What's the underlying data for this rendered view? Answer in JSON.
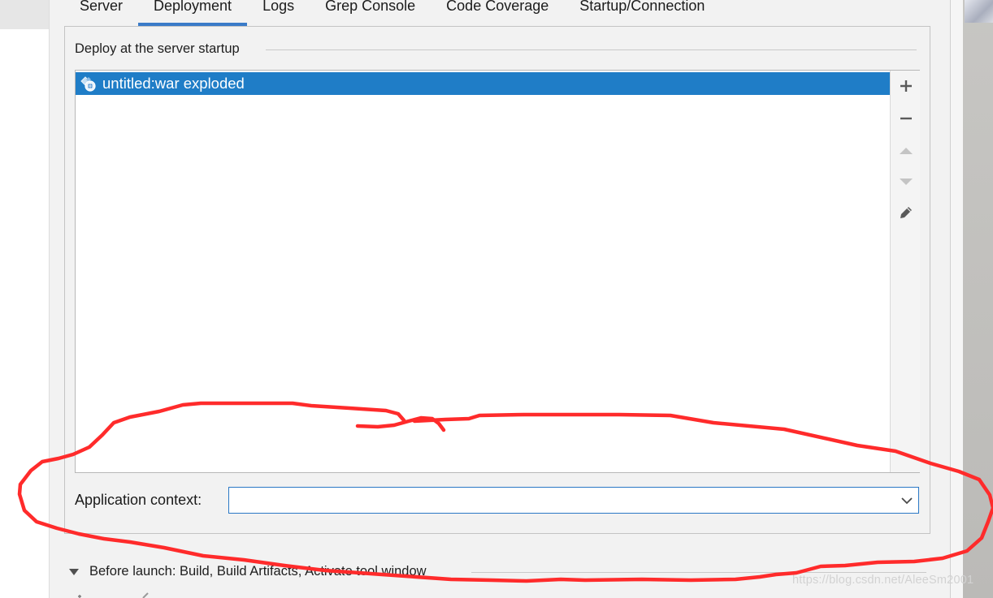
{
  "tabs": [
    {
      "label": "Server",
      "active": false
    },
    {
      "label": "Deployment",
      "active": true
    },
    {
      "label": "Logs",
      "active": false
    },
    {
      "label": "Grep Console",
      "active": false
    },
    {
      "label": "Code Coverage",
      "active": false
    },
    {
      "label": "Startup/Connection",
      "active": false
    }
  ],
  "deploy": {
    "section_title": "Deploy at the server startup",
    "items": [
      {
        "label": "untitled:war exploded",
        "icon": "artifact-icon",
        "selected": true
      }
    ],
    "toolbar": {
      "add_icon": "plus-icon",
      "remove_icon": "minus-icon",
      "move_up_icon": "arrow-up-icon",
      "move_down_icon": "arrow-down-icon",
      "edit_icon": "pencil-icon"
    }
  },
  "app_context": {
    "label": "Application context:",
    "value": ""
  },
  "before_launch": {
    "label": "Before launch: Build, Build Artifacts, Activate tool window"
  },
  "watermark": "https://blog.csdn.net/AleeSm2001",
  "colors": {
    "selection": "#1f7dc7",
    "active_tab_underline": "#3a7bc8",
    "focus_border": "#2a78c5",
    "annotation": "#ff2b2b",
    "panel_background": "#f2f2f2"
  }
}
